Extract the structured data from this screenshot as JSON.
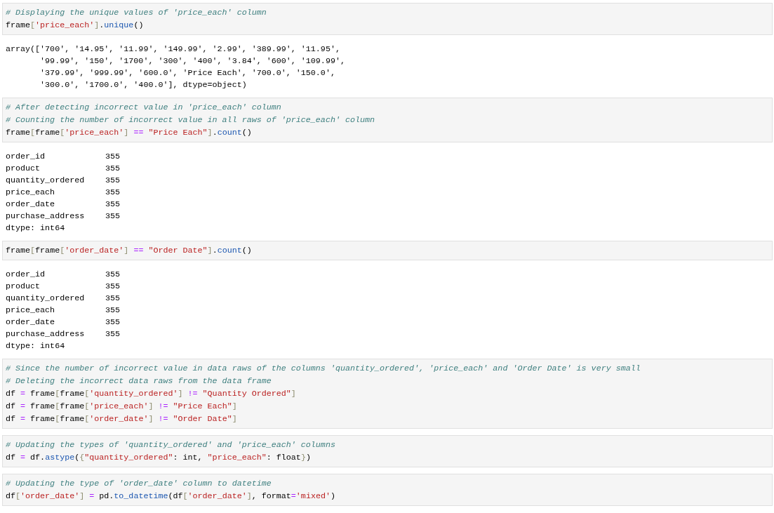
{
  "cells": [
    {
      "kind": "code",
      "lines": [
        [
          {
            "kind": "comment",
            "t": "# Displaying the unique values of 'price_each' column"
          }
        ],
        [
          {
            "kind": "name",
            "t": "frame"
          },
          {
            "kind": "bracket",
            "t": "["
          },
          {
            "kind": "string",
            "t": "'price_each'"
          },
          {
            "kind": "bracket",
            "t": "]"
          },
          {
            "kind": "name",
            "t": "."
          },
          {
            "kind": "func",
            "t": "unique"
          },
          {
            "kind": "name",
            "t": "()"
          }
        ]
      ]
    },
    {
      "kind": "text",
      "lines": [
        "array(['700', '14.95', '11.99', '149.99', '2.99', '389.99', '11.95',",
        "       '99.99', '150', '1700', '300', '400', '3.84', '600', '109.99',",
        "       '379.99', '999.99', '600.0', 'Price Each', '700.0', '150.0',",
        "       '300.0', '1700.0', '400.0'], dtype=object)"
      ]
    },
    {
      "kind": "code",
      "lines": [
        [
          {
            "kind": "comment",
            "t": "# After detecting incorrect value in 'price_each' column"
          }
        ],
        [
          {
            "kind": "comment",
            "t": "# Counting the number of incorrect value in all raws of 'price_each' column"
          }
        ],
        [
          {
            "kind": "name",
            "t": "frame"
          },
          {
            "kind": "bracket",
            "t": "["
          },
          {
            "kind": "name",
            "t": "frame"
          },
          {
            "kind": "bracket",
            "t": "["
          },
          {
            "kind": "string",
            "t": "'price_each'"
          },
          {
            "kind": "bracket",
            "t": "]"
          },
          {
            "kind": "operator",
            "t": " == "
          },
          {
            "kind": "string",
            "t": "\"Price Each\""
          },
          {
            "kind": "bracket",
            "t": "]"
          },
          {
            "kind": "name",
            "t": "."
          },
          {
            "kind": "func",
            "t": "count"
          },
          {
            "kind": "name",
            "t": "()"
          }
        ]
      ]
    },
    {
      "kind": "series",
      "rows": [
        {
          "label": "order_id",
          "value": "355"
        },
        {
          "label": "product",
          "value": "355"
        },
        {
          "label": "quantity_ordered",
          "value": "355"
        },
        {
          "label": "price_each",
          "value": "355"
        },
        {
          "label": "order_date",
          "value": "355"
        },
        {
          "label": "purchase_address",
          "value": "355"
        }
      ],
      "dtype": "dtype: int64"
    },
    {
      "kind": "code",
      "lines": [
        [
          {
            "kind": "name",
            "t": "frame"
          },
          {
            "kind": "bracket",
            "t": "["
          },
          {
            "kind": "name",
            "t": "frame"
          },
          {
            "kind": "bracket",
            "t": "["
          },
          {
            "kind": "string",
            "t": "'order_date'"
          },
          {
            "kind": "bracket",
            "t": "]"
          },
          {
            "kind": "operator",
            "t": " == "
          },
          {
            "kind": "string",
            "t": "\"Order Date\""
          },
          {
            "kind": "bracket",
            "t": "]"
          },
          {
            "kind": "name",
            "t": "."
          },
          {
            "kind": "func",
            "t": "count"
          },
          {
            "kind": "name",
            "t": "()"
          }
        ]
      ]
    },
    {
      "kind": "series",
      "rows": [
        {
          "label": "order_id",
          "value": "355"
        },
        {
          "label": "product",
          "value": "355"
        },
        {
          "label": "quantity_ordered",
          "value": "355"
        },
        {
          "label": "price_each",
          "value": "355"
        },
        {
          "label": "order_date",
          "value": "355"
        },
        {
          "label": "purchase_address",
          "value": "355"
        }
      ],
      "dtype": "dtype: int64"
    },
    {
      "kind": "code",
      "lines": [
        [
          {
            "kind": "comment",
            "t": "# Since the number of incorrect value in data raws of the columns 'quantity_ordered', 'price_each' and 'Order Date' is very small"
          }
        ],
        [
          {
            "kind": "comment",
            "t": "# Deleting the incorrect data raws from the data frame"
          }
        ],
        [
          {
            "kind": "name",
            "t": "df "
          },
          {
            "kind": "operator",
            "t": "="
          },
          {
            "kind": "name",
            "t": " frame"
          },
          {
            "kind": "bracket",
            "t": "["
          },
          {
            "kind": "name",
            "t": "frame"
          },
          {
            "kind": "bracket",
            "t": "["
          },
          {
            "kind": "string",
            "t": "'quantity_ordered'"
          },
          {
            "kind": "bracket",
            "t": "]"
          },
          {
            "kind": "operator",
            "t": " != "
          },
          {
            "kind": "string",
            "t": "\"Quantity Ordered\""
          },
          {
            "kind": "bracket",
            "t": "]"
          }
        ],
        [
          {
            "kind": "name",
            "t": "df "
          },
          {
            "kind": "operator",
            "t": "="
          },
          {
            "kind": "name",
            "t": " frame"
          },
          {
            "kind": "bracket",
            "t": "["
          },
          {
            "kind": "name",
            "t": "frame"
          },
          {
            "kind": "bracket",
            "t": "["
          },
          {
            "kind": "string",
            "t": "'price_each'"
          },
          {
            "kind": "bracket",
            "t": "]"
          },
          {
            "kind": "operator",
            "t": " != "
          },
          {
            "kind": "string",
            "t": "\"Price Each\""
          },
          {
            "kind": "bracket",
            "t": "]"
          }
        ],
        [
          {
            "kind": "name",
            "t": "df "
          },
          {
            "kind": "operator",
            "t": "="
          },
          {
            "kind": "name",
            "t": " frame"
          },
          {
            "kind": "bracket",
            "t": "["
          },
          {
            "kind": "name",
            "t": "frame"
          },
          {
            "kind": "bracket",
            "t": "["
          },
          {
            "kind": "string",
            "t": "'order_date'"
          },
          {
            "kind": "bracket",
            "t": "]"
          },
          {
            "kind": "operator",
            "t": " != "
          },
          {
            "kind": "string",
            "t": "\"Order Date\""
          },
          {
            "kind": "bracket",
            "t": "]"
          }
        ]
      ]
    },
    {
      "kind": "code",
      "lines": [
        [
          {
            "kind": "comment",
            "t": "# Updating the types of 'quantity_ordered' and 'price_each' columns"
          }
        ],
        [
          {
            "kind": "name",
            "t": "df "
          },
          {
            "kind": "operator",
            "t": "="
          },
          {
            "kind": "name",
            "t": " df."
          },
          {
            "kind": "func",
            "t": "astype"
          },
          {
            "kind": "name",
            "t": "("
          },
          {
            "kind": "bracket",
            "t": "{"
          },
          {
            "kind": "string",
            "t": "\"quantity_ordered\""
          },
          {
            "kind": "name",
            "t": ": int, "
          },
          {
            "kind": "string",
            "t": "\"price_each\""
          },
          {
            "kind": "name",
            "t": ": float"
          },
          {
            "kind": "bracket",
            "t": "}"
          },
          {
            "kind": "name",
            "t": ")"
          }
        ]
      ]
    },
    {
      "kind": "code",
      "lines": [
        [
          {
            "kind": "comment",
            "t": "# Updating the type of 'order_date' column to datetime"
          }
        ],
        [
          {
            "kind": "name",
            "t": "df"
          },
          {
            "kind": "bracket",
            "t": "["
          },
          {
            "kind": "string",
            "t": "'order_date'"
          },
          {
            "kind": "bracket",
            "t": "]"
          },
          {
            "kind": "operator",
            "t": " ="
          },
          {
            "kind": "name",
            "t": " pd."
          },
          {
            "kind": "func",
            "t": "to_datetime"
          },
          {
            "kind": "name",
            "t": "(df"
          },
          {
            "kind": "bracket",
            "t": "["
          },
          {
            "kind": "string",
            "t": "'order_date'"
          },
          {
            "kind": "bracket",
            "t": "]"
          },
          {
            "kind": "name",
            "t": ", format"
          },
          {
            "kind": "operator",
            "t": "="
          },
          {
            "kind": "string",
            "t": "'mixed'"
          },
          {
            "kind": "name",
            "t": ")"
          }
        ]
      ]
    }
  ]
}
